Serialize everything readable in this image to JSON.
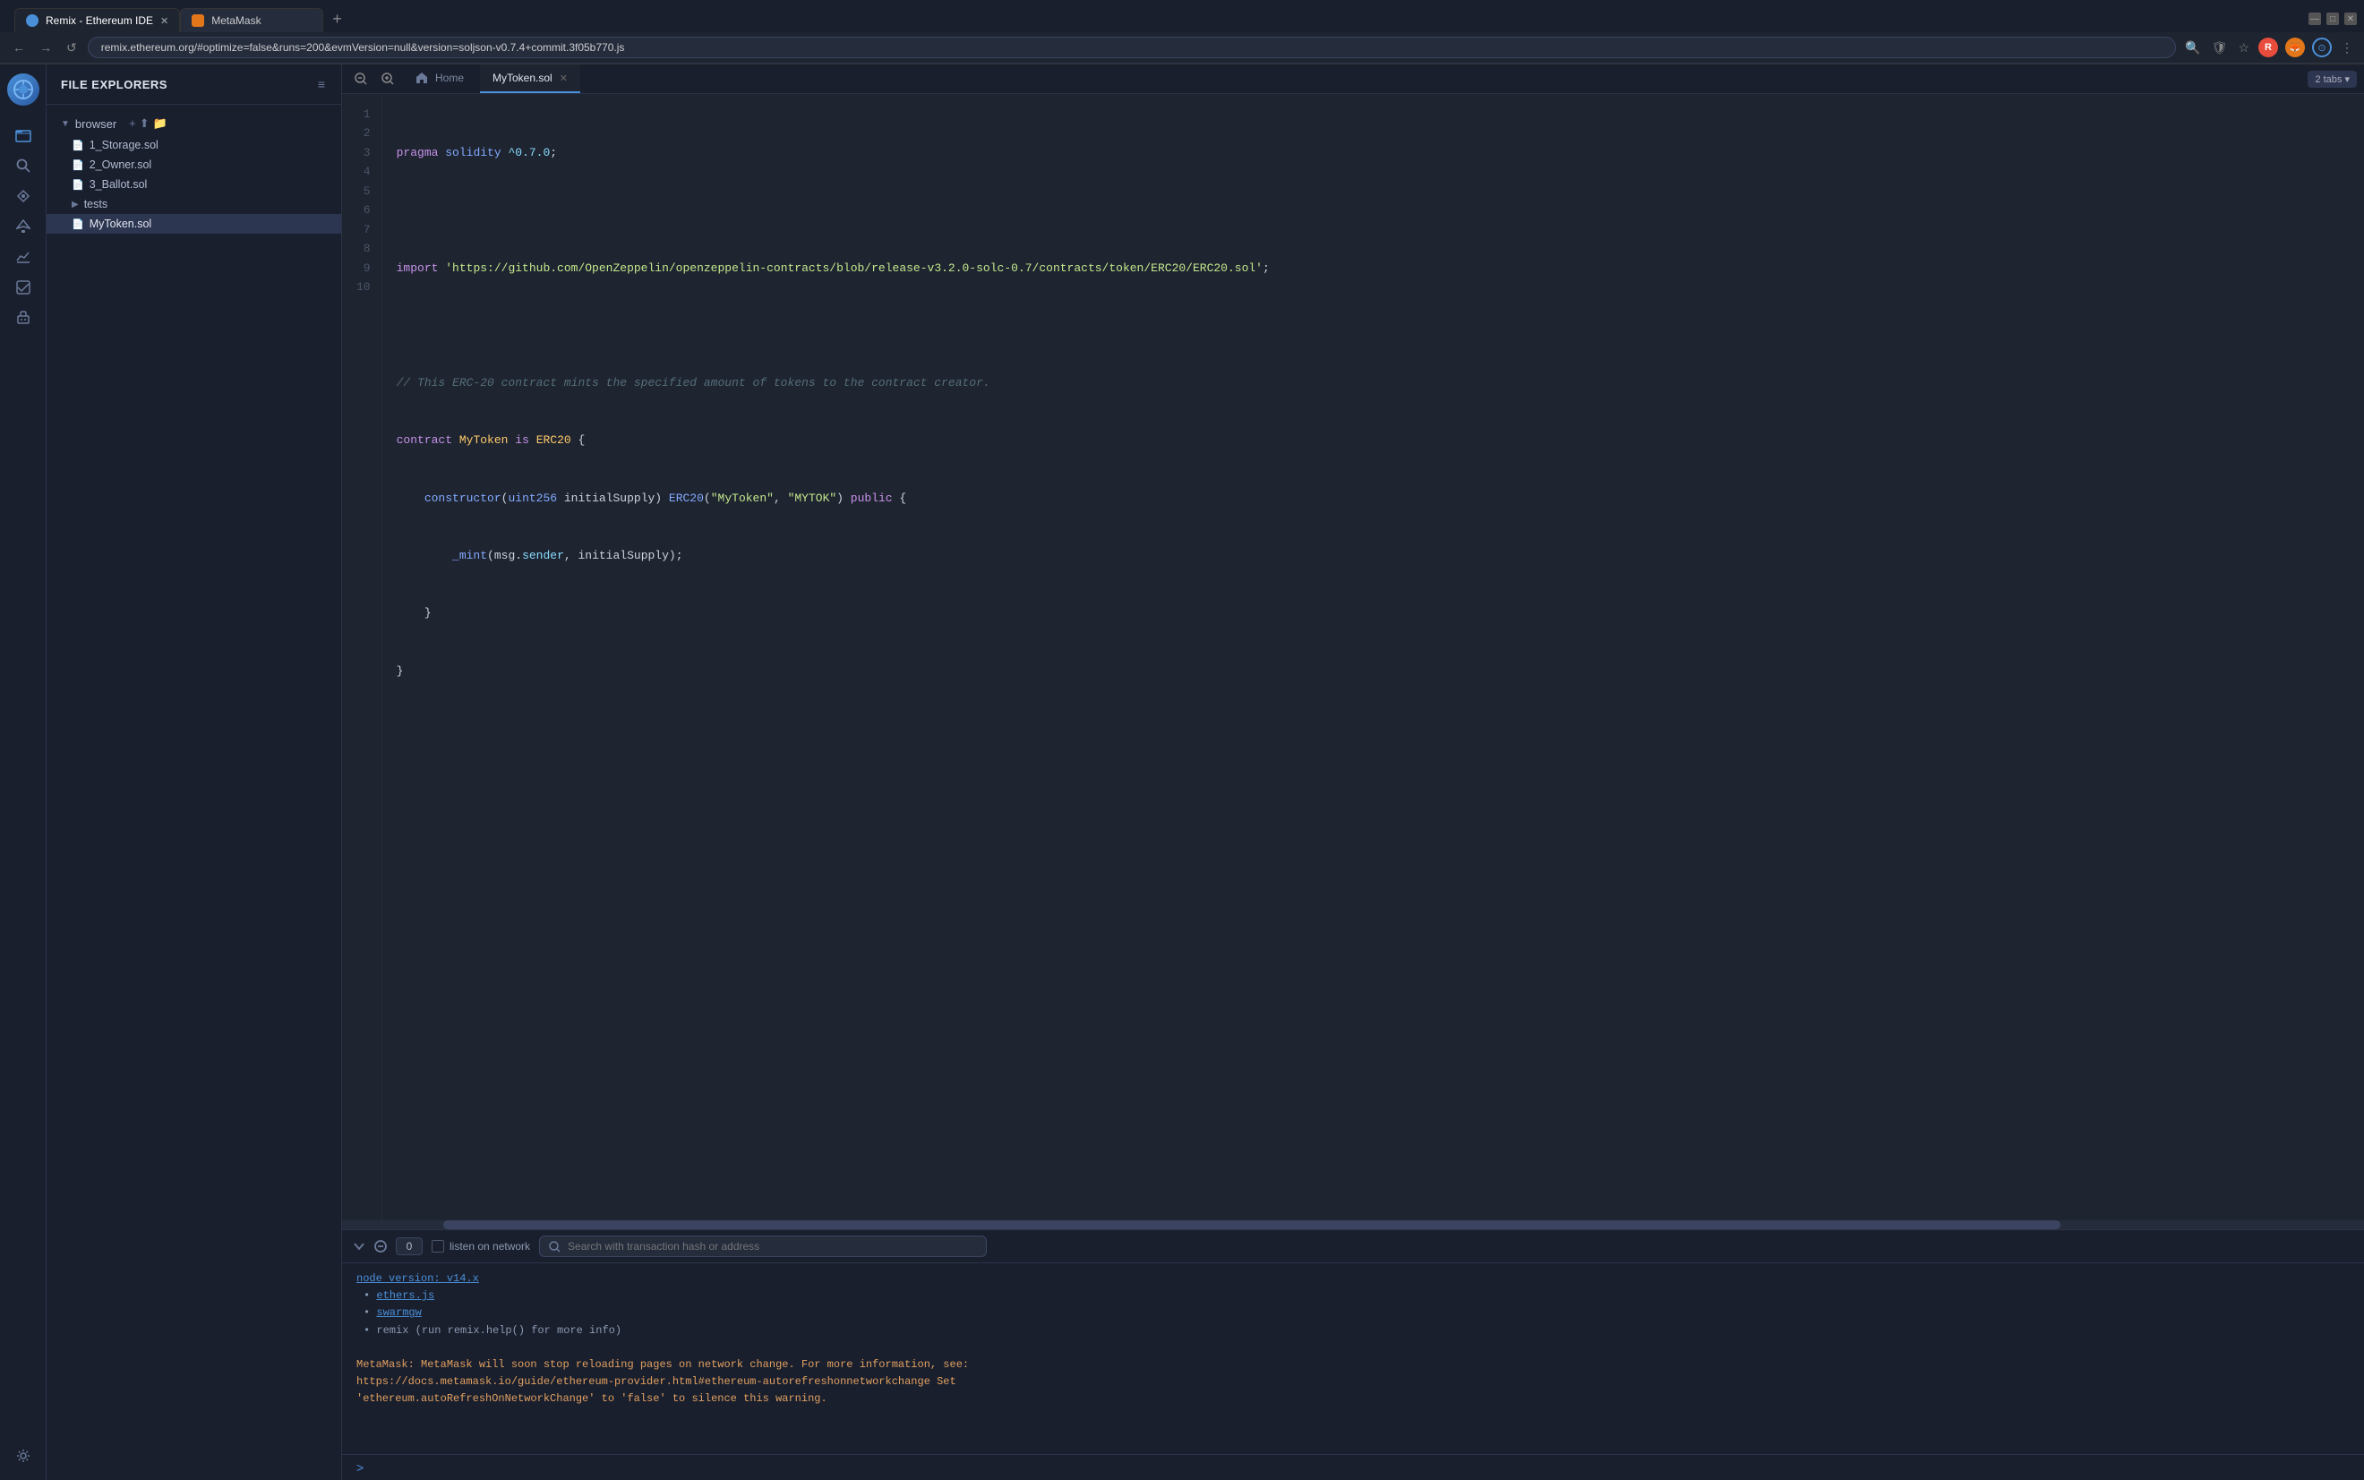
{
  "browser": {
    "tabs": [
      {
        "id": "remix",
        "label": "Remix - Ethereum IDE",
        "active": true,
        "icon": "remix"
      },
      {
        "id": "metamask",
        "label": "MetaMask",
        "active": false,
        "icon": "metamask"
      }
    ],
    "new_tab_icon": "+",
    "address": "remix.ethereum.org/#optimize=false&runs=200&evmVersion=null&version=soljson-v0.7.4+commit.3f05b770.js",
    "nav": {
      "back": "←",
      "forward": "→",
      "reload": "↺"
    },
    "title_controls": {
      "minimize": "—",
      "maximize": "□",
      "close": "✕"
    }
  },
  "sidebar": {
    "icons": [
      {
        "id": "file-explorer",
        "icon": "📁",
        "active": true
      },
      {
        "id": "search",
        "icon": "🔍",
        "active": false
      },
      {
        "id": "compiler",
        "icon": "⚙",
        "active": false
      },
      {
        "id": "deploy",
        "icon": "🚀",
        "active": false
      },
      {
        "id": "plugin",
        "icon": "🔌",
        "active": false
      },
      {
        "id": "chart",
        "icon": "📈",
        "active": false
      }
    ],
    "bottom_icon": {
      "id": "settings",
      "icon": "⚙"
    }
  },
  "file_explorer": {
    "title": "FILE EXPLORERS",
    "menu_icon": "≡",
    "browser_folder": "browser",
    "folder_actions": [
      "+",
      "⬆",
      "📁"
    ],
    "files": [
      {
        "name": "1_Storage.sol",
        "indent": 1
      },
      {
        "name": "2_Owner.sol",
        "indent": 1
      },
      {
        "name": "3_Ballot.sol",
        "indent": 1
      }
    ],
    "tests_folder": "tests",
    "active_file": "MyToken.sol"
  },
  "editor": {
    "tabs": [
      {
        "id": "home",
        "label": "Home",
        "icon": "🏠",
        "active": false
      },
      {
        "id": "mytoken",
        "label": "MyToken.sol",
        "active": true,
        "closable": true
      }
    ],
    "tabs_count": "2 tabs ▾",
    "zoom_in": "+",
    "zoom_out": "−",
    "lines": [
      {
        "num": 1,
        "code": "<span class='kw-keyword'>pragma</span> <span class='kw-type'>solidity</span> <span class='kw-special'>^0.7.0</span>;"
      },
      {
        "num": 2,
        "code": ""
      },
      {
        "num": 3,
        "code": "<span class='kw-keyword'>import</span> <span class='kw-string'>'https://github.com/OpenZeppelin/openzeppelin-contracts/blob/release-v3.2.0-solc-0.7/contracts/token/ERC20/ERC20.sol'</span>;"
      },
      {
        "num": 4,
        "code": ""
      },
      {
        "num": 5,
        "code": "<span class='kw-comment'>// This ERC-20 contract mints the specified amount of tokens to the contract creator.</span>"
      },
      {
        "num": 6,
        "code": "<span class='kw-keyword'>contract</span> <span class='kw-contract'>MyToken</span> <span class='kw-keyword'>is</span> <span class='kw-contract'>ERC20</span> {"
      },
      {
        "num": 7,
        "code": "    <span class='kw-func'>constructor</span>(<span class='kw-type'>uint256</span> initialSupply) <span class='kw-func'>ERC20</span>(<span class='kw-string'>\"MyToken\"</span>, <span class='kw-string'>\"MYTOK\"</span>) <span class='kw-keyword'>public</span> {"
      },
      {
        "num": 8,
        "code": "        <span class='kw-func'>_mint</span>(msg.<span class='kw-special'>sender</span>, initialSupply);"
      },
      {
        "num": 9,
        "code": "    }"
      },
      {
        "num": 10,
        "code": "}"
      }
    ]
  },
  "console": {
    "collapse_btn": "⬇",
    "clear_btn": "⊘",
    "counter": "0",
    "listen_label": "listen on network",
    "search_placeholder": "Search with transaction hash or address",
    "output_lines": [
      {
        "type": "link",
        "text": "node version: v14.x",
        "is_link": true
      },
      {
        "type": "bullet",
        "text": "ethers.js",
        "is_link": true
      },
      {
        "type": "bullet",
        "text": "swarmgw",
        "is_link": true
      },
      {
        "type": "bullet",
        "text": "remix (run remix.help() for more info)",
        "is_link": false
      }
    ],
    "warning": "MetaMask: MetaMask will soon stop reloading pages on network change. For more information, see:\nhttps://docs.metamask.io/guide/ethereum-provider.html#ethereum-autorefreshonnetworkchange Set\n'ethereum.autoRefreshOnNetworkChange' to 'false' to silence this warning.",
    "prompt": ">"
  }
}
